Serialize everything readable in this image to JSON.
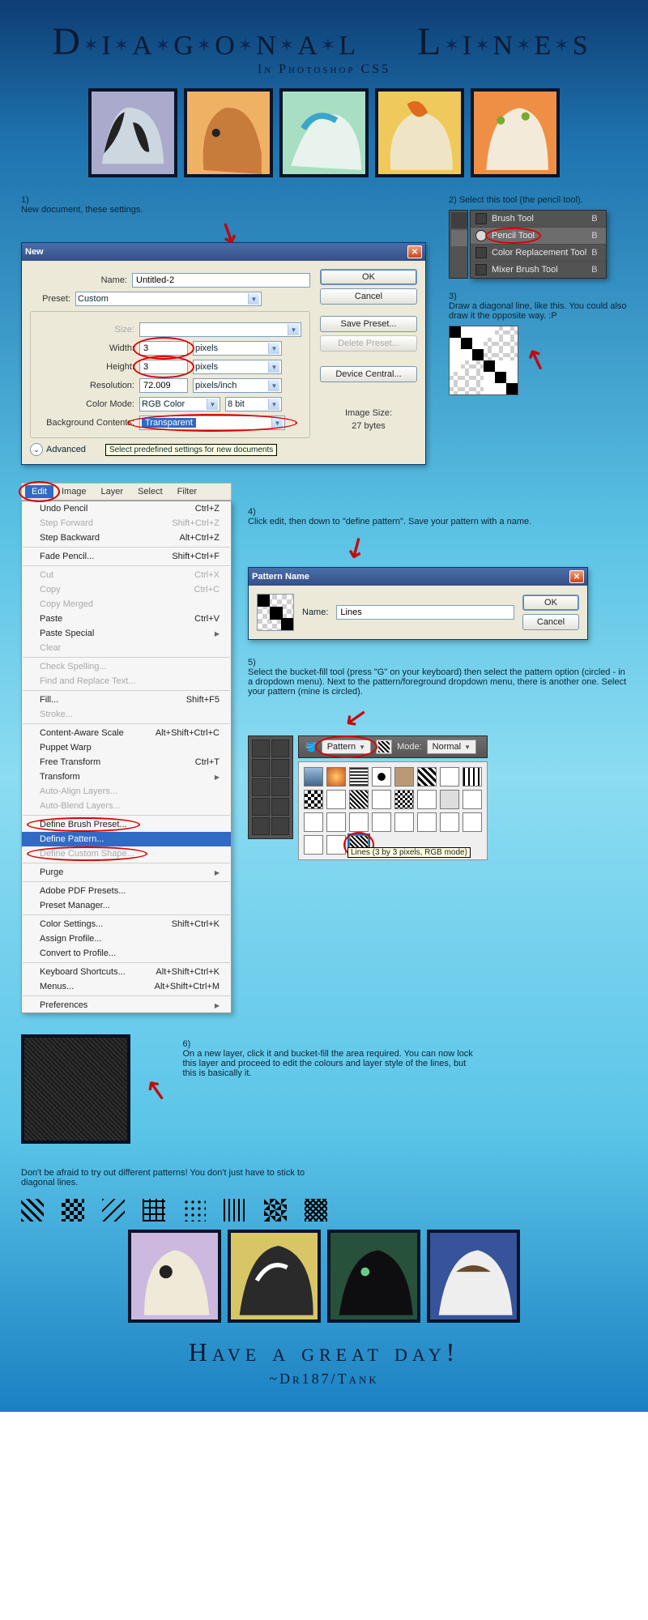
{
  "header": {
    "title": "Diagonal Lines",
    "subtitle": "In Photoshop CS5"
  },
  "steps": {
    "s1": "1)\nNew document, these settings.",
    "s2": "2) Select this tool (the pencil tool).",
    "s3": "3)\nDraw a diagonal line, like this. You could also draw it the opposite way. :P",
    "s4": "4)\nClick edit, then down to \"define pattern\". Save your pattern with a name.",
    "s5": "5)\nSelect the bucket-fill tool (press \"G\" on your keyboard) then select the pattern option (circled - in a dropdown menu). Next to the pattern/foreground dropdown menu, there is another one. Select your pattern (mine is circled).",
    "s6": "6)\nOn a new layer, click it and bucket-fill the area required. You can now lock this layer and proceed to edit the colours and layer style of the lines, but this is basically it.",
    "hint": "Don't be afraid to try out different patterns! You don't just have to stick to diagonal lines."
  },
  "newDialog": {
    "title": "New",
    "labels": {
      "name": "Name:",
      "preset": "Preset:",
      "size": "Size:",
      "width": "Width:",
      "height": "Height:",
      "resolution": "Resolution:",
      "colorMode": "Color Mode:",
      "bg": "Background Contents:",
      "advanced": "Advanced",
      "imageSizeLbl": "Image Size:"
    },
    "values": {
      "name": "Untitled-2",
      "preset": "Custom",
      "width": "3",
      "height": "3",
      "widthUnit": "pixels",
      "heightUnit": "pixels",
      "resolution": "72.009",
      "resUnit": "pixels/inch",
      "colorMode": "RGB Color",
      "bitDepth": "8 bit",
      "bg": "Transparent",
      "imageSize": "27 bytes"
    },
    "buttons": {
      "ok": "OK",
      "cancel": "Cancel",
      "save": "Save Preset...",
      "delete": "Delete Preset...",
      "device": "Device Central..."
    },
    "tooltip": "Select predefined settings for new documents"
  },
  "toolFlyout": {
    "items": [
      {
        "name": "Brush Tool",
        "key": "B"
      },
      {
        "name": "Pencil Tool",
        "key": "B",
        "selected": true,
        "circled": true
      },
      {
        "name": "Color Replacement Tool",
        "key": "B"
      },
      {
        "name": "Mixer Brush Tool",
        "key": "B"
      }
    ]
  },
  "menubar": [
    "Edit",
    "Image",
    "Layer",
    "Select",
    "Filter"
  ],
  "editMenu": [
    {
      "l": "Undo Pencil",
      "k": "Ctrl+Z"
    },
    {
      "l": "Step Forward",
      "k": "Shift+Ctrl+Z",
      "d": true
    },
    {
      "l": "Step Backward",
      "k": "Alt+Ctrl+Z"
    },
    {
      "sep": true
    },
    {
      "l": "Fade Pencil...",
      "k": "Shift+Ctrl+F"
    },
    {
      "sep": true
    },
    {
      "l": "Cut",
      "k": "Ctrl+X",
      "d": true
    },
    {
      "l": "Copy",
      "k": "Ctrl+C",
      "d": true
    },
    {
      "l": "Copy Merged",
      "d": true
    },
    {
      "l": "Paste",
      "k": "Ctrl+V"
    },
    {
      "l": "Paste Special",
      "sub": true
    },
    {
      "l": "Clear",
      "d": true
    },
    {
      "sep": true
    },
    {
      "l": "Check Spelling...",
      "d": true
    },
    {
      "l": "Find and Replace Text...",
      "d": true
    },
    {
      "sep": true
    },
    {
      "l": "Fill...",
      "k": "Shift+F5"
    },
    {
      "l": "Stroke...",
      "d": true
    },
    {
      "sep": true
    },
    {
      "l": "Content-Aware Scale",
      "k": "Alt+Shift+Ctrl+C"
    },
    {
      "l": "Puppet Warp"
    },
    {
      "l": "Free Transform",
      "k": "Ctrl+T"
    },
    {
      "l": "Transform",
      "sub": true
    },
    {
      "l": "Auto-Align Layers...",
      "d": true
    },
    {
      "l": "Auto-Blend Layers...",
      "d": true
    },
    {
      "sep": true
    },
    {
      "l": "Define Brush Preset...",
      "circ": true
    },
    {
      "l": "Define Pattern...",
      "sel": true
    },
    {
      "l": "Define Custom Shape...",
      "d": true,
      "circ": true
    },
    {
      "sep": true
    },
    {
      "l": "Purge",
      "sub": true
    },
    {
      "sep": true
    },
    {
      "l": "Adobe PDF Presets..."
    },
    {
      "l": "Preset Manager..."
    },
    {
      "sep": true
    },
    {
      "l": "Color Settings...",
      "k": "Shift+Ctrl+K"
    },
    {
      "l": "Assign Profile..."
    },
    {
      "l": "Convert to Profile..."
    },
    {
      "sep": true
    },
    {
      "l": "Keyboard Shortcuts...",
      "k": "Alt+Shift+Ctrl+K"
    },
    {
      "l": "Menus...",
      "k": "Alt+Shift+Ctrl+M"
    },
    {
      "sep": true
    },
    {
      "l": "Preferences",
      "sub": true
    }
  ],
  "patternDialog": {
    "title": "Pattern Name",
    "label": "Name:",
    "value": "Lines",
    "ok": "OK",
    "cancel": "Cancel"
  },
  "optbar": {
    "fill": "Pattern",
    "modeLbl": "Mode:",
    "mode": "Normal",
    "tooltip": "Lines (3 by 3 pixels, RGB mode)"
  },
  "footer": {
    "msg": "Have a great day!",
    "sig": "~Dr187/Tank"
  }
}
